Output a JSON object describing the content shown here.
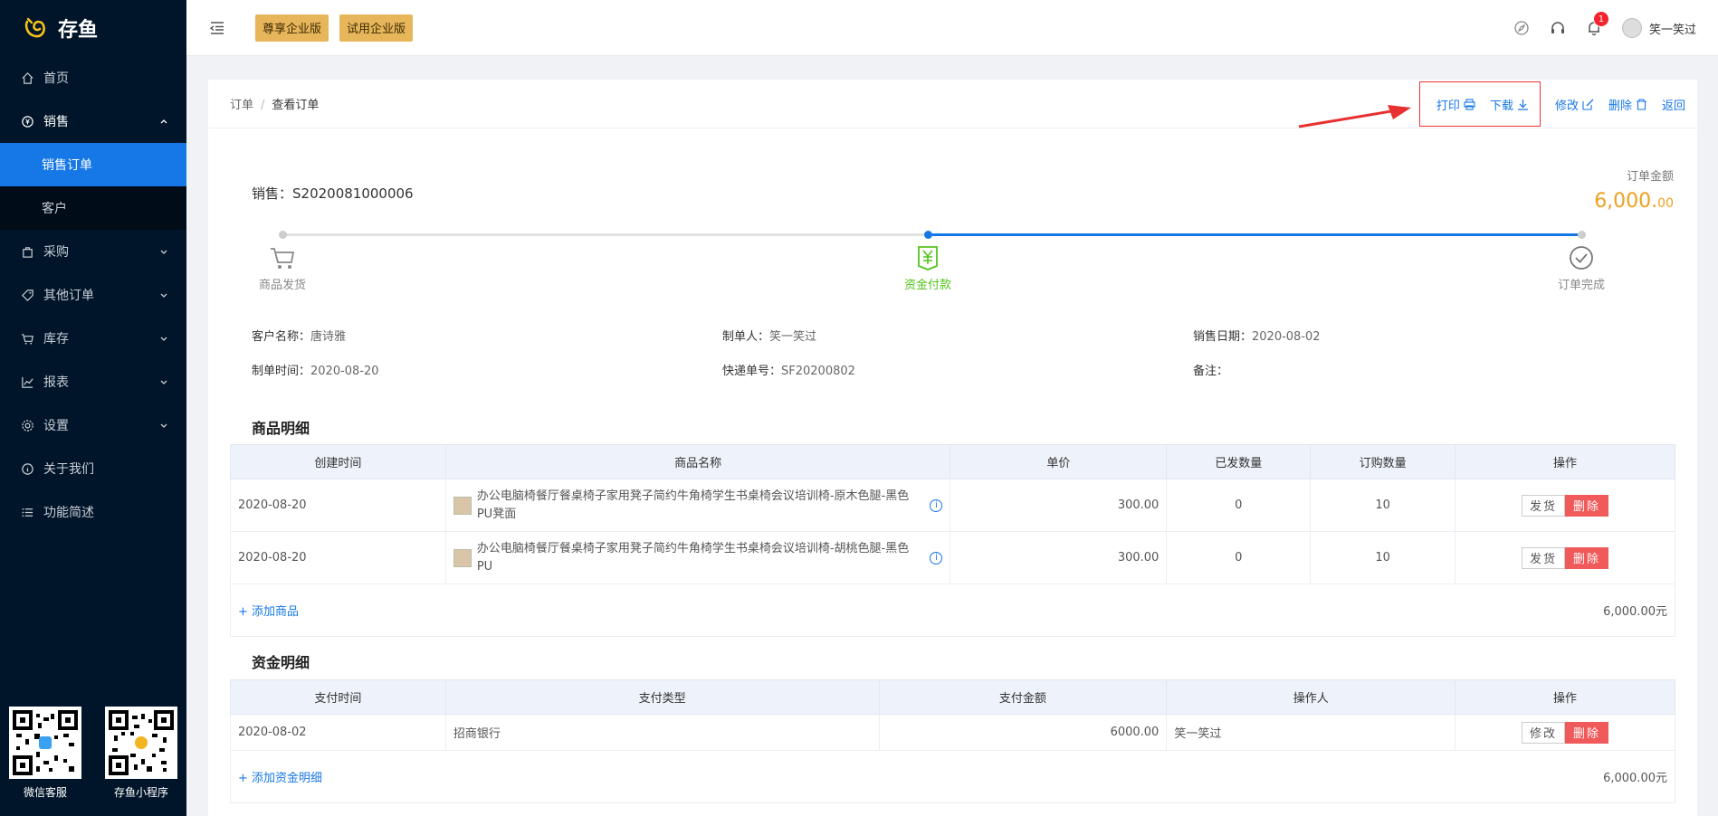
{
  "brand": {
    "name": "存鱼"
  },
  "sidebar": {
    "items": [
      {
        "label": "首页",
        "icon": "home-icon"
      },
      {
        "label": "销售",
        "icon": "sales-icon",
        "open": true,
        "children": [
          {
            "label": "销售订单",
            "active": true
          },
          {
            "label": "客户"
          }
        ]
      },
      {
        "label": "采购",
        "icon": "bag-icon"
      },
      {
        "label": "其他订单",
        "icon": "tag-icon"
      },
      {
        "label": "库存",
        "icon": "cart-icon"
      },
      {
        "label": "报表",
        "icon": "chart-icon"
      },
      {
        "label": "设置",
        "icon": "gear-icon"
      },
      {
        "label": "关于我们",
        "icon": "info-icon"
      },
      {
        "label": "功能简述",
        "icon": "list-icon"
      }
    ],
    "qr": [
      {
        "label": "微信客服"
      },
      {
        "label": "存鱼小程序"
      }
    ]
  },
  "topbar": {
    "badges": [
      "尊享企业版",
      "试用企业版"
    ],
    "notification_count": "1",
    "user_name": "笑一笑过"
  },
  "breadcrumb": {
    "root": "订单",
    "current": "查看订单"
  },
  "actions": {
    "print": "打印",
    "download": "下载",
    "edit": "修改",
    "delete": "删除",
    "back": "返回"
  },
  "order": {
    "title_prefix": "销售：",
    "number": "S2020081000006",
    "amount_label": "订单金额",
    "amount_int": "6,000.",
    "amount_dec": "00"
  },
  "steps": [
    {
      "label": "商品发货",
      "icon": "cart-icon",
      "state": "done"
    },
    {
      "label": "资金付款",
      "icon": "yen-icon",
      "state": "current"
    },
    {
      "label": "订单完成",
      "icon": "check-circle-icon",
      "state": "pending"
    }
  ],
  "info": {
    "customer_label": "客户名称：",
    "customer": "唐诗雅",
    "maker_label": "制单人：",
    "maker": "笑一笑过",
    "sale_date_label": "销售日期：",
    "sale_date": "2020-08-02",
    "make_time_label": "制单时间：",
    "make_time": "2020-08-20",
    "express_label": "快递单号：",
    "express": "SF20200802",
    "remark_label": "备注：",
    "remark": ""
  },
  "goods": {
    "title": "商品明细",
    "headers": [
      "创建时间",
      "商品名称",
      "单价",
      "已发数量",
      "订购数量",
      "操作"
    ],
    "rows": [
      {
        "created": "2020-08-20",
        "name": "办公电脑椅餐厅餐桌椅子家用凳子简约牛角椅学生书桌椅会议培训椅-原木色腿-黑色PU凳面",
        "price": "300.00",
        "shipped": "0",
        "ordered": "10"
      },
      {
        "created": "2020-08-20",
        "name": "办公电脑椅餐厅餐桌椅子家用凳子简约牛角椅学生书桌椅会议培训椅-胡桃色腿-黑色PU",
        "price": "300.00",
        "shipped": "0",
        "ordered": "10"
      }
    ],
    "ship_label": "发货",
    "delete_label": "删除",
    "add_label": "添加商品",
    "total": "6,000.00元"
  },
  "funds": {
    "title": "资金明细",
    "headers": [
      "支付时间",
      "支付类型",
      "支付金额",
      "操作人",
      "操作"
    ],
    "rows": [
      {
        "time": "2020-08-02",
        "type": "招商银行",
        "amount": "6000.00",
        "operator": "笑一笑过"
      }
    ],
    "edit_label": "修改",
    "delete_label": "删除",
    "add_label": "添加资金明细",
    "total": "6,000.00元"
  },
  "colors": {
    "primary": "#1677e6",
    "sidebar": "#001529",
    "gold": "#e8b65a",
    "amount": "#f0a020",
    "danger": "#f05a5a",
    "step_done": "#52c41a"
  }
}
